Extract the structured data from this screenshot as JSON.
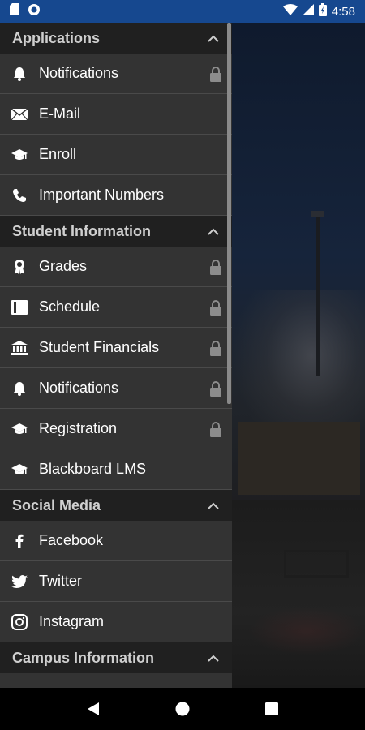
{
  "status_bar": {
    "time": "4:58",
    "icons": [
      "sd-card-icon",
      "sync-icon",
      "wifi-icon",
      "signal-icon",
      "battery-icon"
    ]
  },
  "sections": [
    {
      "title": "Applications",
      "items": [
        {
          "label": "Notifications",
          "icon": "bell-icon",
          "locked": true
        },
        {
          "label": "E-Mail",
          "icon": "mail-icon",
          "locked": false
        },
        {
          "label": "Enroll",
          "icon": "graduation-cap-icon",
          "locked": false
        },
        {
          "label": "Important Numbers",
          "icon": "phone-icon",
          "locked": false
        }
      ]
    },
    {
      "title": "Student Information",
      "items": [
        {
          "label": "Grades",
          "icon": "award-icon",
          "locked": true
        },
        {
          "label": "Schedule",
          "icon": "book-icon",
          "locked": true
        },
        {
          "label": "Student Financials",
          "icon": "bank-icon",
          "locked": true
        },
        {
          "label": "Notifications",
          "icon": "bell-icon",
          "locked": true
        },
        {
          "label": "Registration",
          "icon": "graduation-cap-icon",
          "locked": true
        },
        {
          "label": "Blackboard LMS",
          "icon": "graduation-cap-icon",
          "locked": false
        }
      ]
    },
    {
      "title": "Social Media",
      "items": [
        {
          "label": "Facebook",
          "icon": "facebook-icon",
          "locked": false
        },
        {
          "label": "Twitter",
          "icon": "twitter-icon",
          "locked": false
        },
        {
          "label": "Instagram",
          "icon": "instagram-icon",
          "locked": false
        }
      ]
    },
    {
      "title": "Campus Information",
      "items": []
    }
  ],
  "colors": {
    "status_bar": "#16488f",
    "drawer_bg": "#333333",
    "header_bg": "#202020",
    "item_text": "#ffffff",
    "header_text": "#cfcfcf",
    "lock": "#8c8c8c"
  },
  "nav_bar": {
    "buttons": [
      "back-icon",
      "home-icon",
      "recents-icon"
    ]
  }
}
